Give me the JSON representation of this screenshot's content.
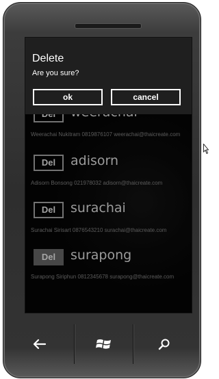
{
  "dialog": {
    "title": "Delete",
    "message": "Are you sure?",
    "ok_label": "ok",
    "cancel_label": "cancel"
  },
  "contacts": [
    {
      "del_label": "Del",
      "name": "weerachai",
      "detail": "Weerachai Nukitram 0819876107 weerachai@thaicreate.com"
    },
    {
      "del_label": "Del",
      "name": "adisorn",
      "detail": "Adisorn Bonsong 021978032 adisorn@thaicreate.com"
    },
    {
      "del_label": "Del",
      "name": "surachai",
      "detail": "Surachai Sirisart 0876543210 surachai@thaicreate.com"
    },
    {
      "del_label": "Del",
      "name": "surapong",
      "detail": "Surapong Siriphun 0812345678 surapong@thaicreate.com"
    }
  ],
  "hardware_buttons": {
    "back": "back-arrow-icon",
    "start": "windows-logo-icon",
    "search": "search-icon"
  },
  "colors": {
    "screen_bg": "#050505",
    "dialog_bg": "#1f1f1f",
    "pressed_button": "#5f5f5f"
  }
}
